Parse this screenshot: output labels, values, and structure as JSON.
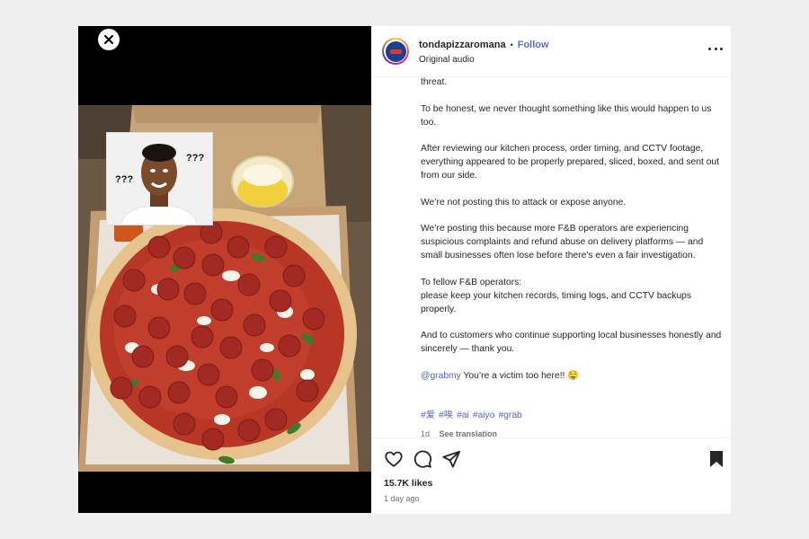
{
  "media": {
    "close_icon": "close-icon",
    "meme": {
      "q_left": "???",
      "q_right": "???"
    }
  },
  "post": {
    "username": "tondapizzaromana",
    "separator": "•",
    "follow_label": "Follow",
    "audio": "Original audio",
    "more_icon": "more-horizontal-icon"
  },
  "caption": {
    "paragraphs": [
      "threat.",
      "To be honest, we never thought something like this would happen to us too.",
      "After reviewing our kitchen process, order timing, and CCTV footage, everything appeared to be properly prepared, sliced, boxed, and sent out from our side.",
      "We’re not posting this to attack or expose anyone.",
      "We’re posting this because more F&B operators are experiencing suspicious complaints and refund abuse on delivery platforms — and small businesses often lose before there’s even a fair investigation.",
      "To fellow F&B operators:\nplease keep your kitchen records, timing logs, and CCTV backups properly.",
      "And to customers who continue supporting local businesses honestly and sincerely — thank you."
    ],
    "mention": "@grabmy",
    "mention_text": " You’re a victim too here!! 🤤",
    "hashtags": [
      "#爱",
      "#唉",
      "#ai",
      "#aiyo",
      "#grab"
    ],
    "age": "1d",
    "see_translation": "See translation"
  },
  "actions": {
    "like_icon": "heart-icon",
    "comment_icon": "comment-icon",
    "share_icon": "send-icon",
    "save_icon": "bookmark-icon",
    "likes": "15.7K likes",
    "posted": "1 day ago"
  },
  "colors": {
    "link": "#5a6ed4",
    "text": "#262626",
    "muted": "#737373",
    "page_bg": "#efefef"
  }
}
